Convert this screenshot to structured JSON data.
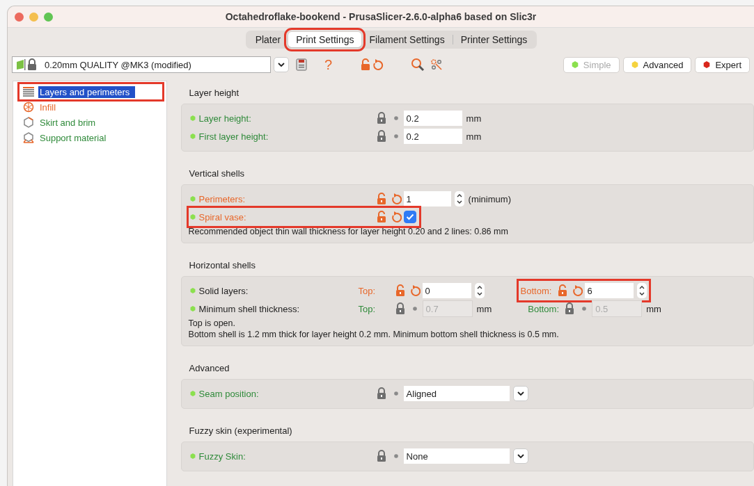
{
  "window": {
    "title": "Octahedroflake-bookend - PrusaSlicer-2.6.0-alpha6 based on Slic3r"
  },
  "tabs": [
    {
      "label": "Plater",
      "selected": false,
      "highlighted": false
    },
    {
      "label": "Print Settings",
      "selected": true,
      "highlighted": true
    },
    {
      "label": "Filament Settings",
      "selected": false,
      "highlighted": false
    },
    {
      "label": "Printer Settings",
      "selected": false,
      "highlighted": false
    }
  ],
  "preset": {
    "value": "0.20mm QUALITY @MK3 (modified)"
  },
  "toolbar": {
    "help": "?"
  },
  "modes": [
    {
      "label": "Simple",
      "color": "#8be04e",
      "disabled": true
    },
    {
      "label": "Advanced",
      "color": "#f5d33f",
      "disabled": false
    },
    {
      "label": "Expert",
      "color": "#d9261c",
      "disabled": false
    }
  ],
  "sidebar": {
    "items": [
      {
        "label": "Layers and perimeters",
        "kind": "layers",
        "selected": true,
        "highlighted": true
      },
      {
        "label": "Infill",
        "kind": "infill",
        "modified": true,
        "selected": false,
        "highlighted": false
      },
      {
        "label": "Skirt and brim",
        "kind": "skirt",
        "modified": false,
        "selected": false,
        "highlighted": false
      },
      {
        "label": "Support material",
        "kind": "support",
        "modified": false,
        "selected": false,
        "highlighted": false
      }
    ]
  },
  "sections": [
    {
      "title": "Layer height",
      "rows": [
        {
          "label": "Layer height:",
          "kind": "option",
          "modified": false,
          "highlighted": false,
          "fields": [
            {
              "kind": "number",
              "modified": false,
              "value": "0.2",
              "unit": "mm",
              "disabled": false
            }
          ]
        },
        {
          "label": "First layer height:",
          "kind": "option",
          "modified": false,
          "highlighted": false,
          "fields": [
            {
              "kind": "number",
              "modified": false,
              "value": "0.2",
              "unit": "mm",
              "disabled": false
            }
          ]
        }
      ]
    },
    {
      "title": "Vertical shells",
      "rows": [
        {
          "label": "Perimeters:",
          "kind": "option",
          "modified": true,
          "highlighted": false,
          "fields": [
            {
              "kind": "spin",
              "modified": true,
              "value": "1",
              "unit": "(minimum)"
            }
          ]
        },
        {
          "label": "Spiral vase:",
          "kind": "option",
          "modified": true,
          "highlighted": true,
          "fields": [
            {
              "kind": "checkbox",
              "modified": true,
              "checked": true
            }
          ]
        }
      ],
      "notes": [
        "Recommended object thin wall thickness for layer height 0.20 and 2 lines: 0.86 mm"
      ]
    },
    {
      "title": "Horizontal shells",
      "rows": [
        {
          "label": "Solid layers:",
          "kind": "group",
          "highlighted": false,
          "fields": [
            {
              "kind": "spin",
              "sublabel": "Top:",
              "modified": true,
              "value": "0",
              "highlighted": false
            },
            {
              "kind": "spin",
              "sublabel": "Bottom:",
              "modified": true,
              "value": "6",
              "highlighted": true
            }
          ]
        },
        {
          "label": "Minimum shell thickness:",
          "kind": "group",
          "highlighted": false,
          "fields": [
            {
              "kind": "number",
              "sublabel": "Top:",
              "modified": false,
              "value": "0.7",
              "unit": "mm",
              "disabled": true
            },
            {
              "kind": "number",
              "sublabel": "Bottom:",
              "modified": false,
              "value": "0.5",
              "unit": "mm",
              "disabled": true
            }
          ]
        }
      ],
      "notes": [
        "Top is open.",
        "Bottom shell is 1.2 mm thick for layer height 0.2 mm. Minimum bottom shell thickness is 0.5 mm."
      ]
    },
    {
      "title": "Advanced",
      "rows": [
        {
          "label": "Seam position:",
          "kind": "option",
          "modified": false,
          "highlighted": false,
          "fields": [
            {
              "kind": "select",
              "modified": false,
              "value": "Aligned"
            }
          ]
        }
      ]
    },
    {
      "title": "Fuzzy skin (experimental)",
      "rows": [
        {
          "label": "Fuzzy Skin:",
          "kind": "option",
          "modified": false,
          "highlighted": false,
          "fields": [
            {
              "kind": "select",
              "modified": false,
              "value": "None"
            }
          ]
        }
      ]
    }
  ]
}
